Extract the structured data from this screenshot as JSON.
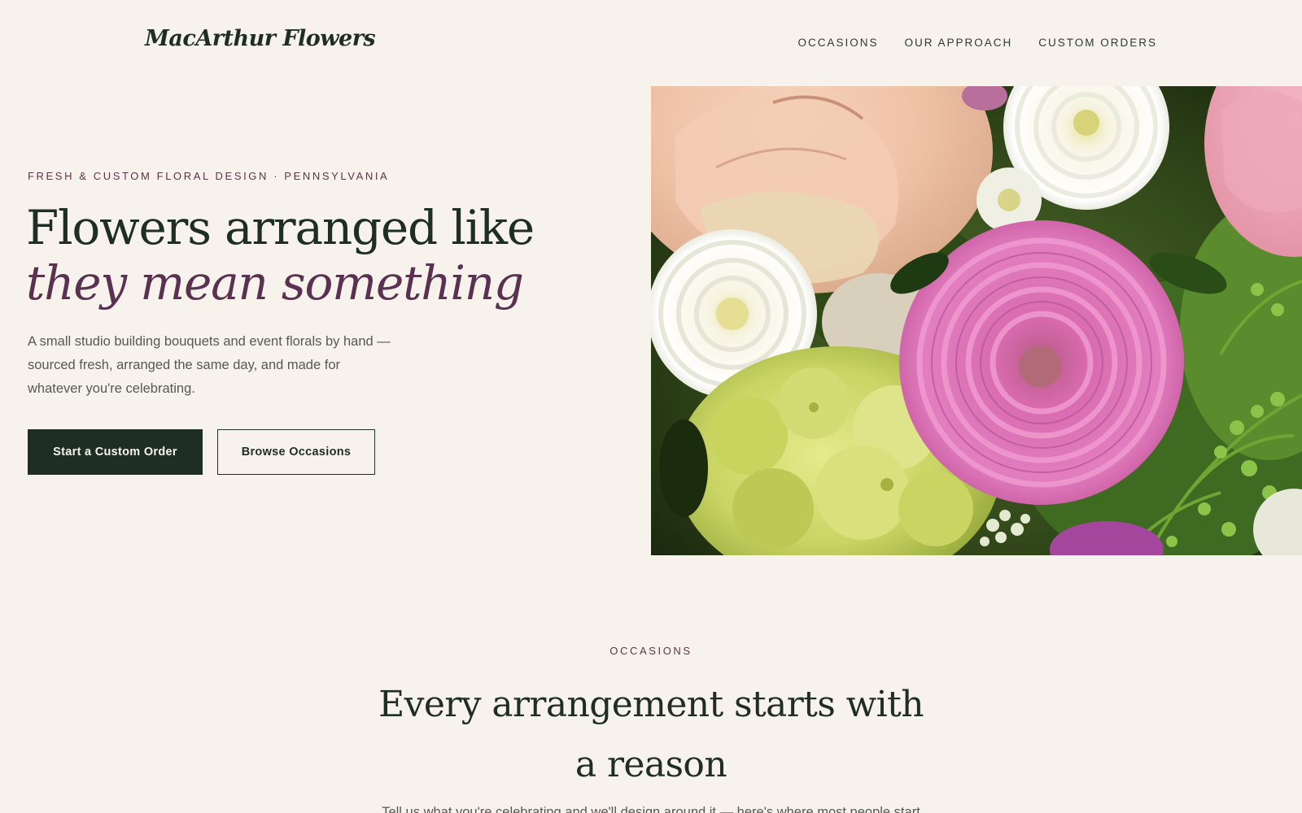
{
  "header": {
    "brand": "MacArthur Flowers",
    "nav": [
      {
        "label": "OCCASIONS"
      },
      {
        "label": "OUR APPROACH"
      },
      {
        "label": "CUSTOM ORDERS"
      }
    ]
  },
  "hero": {
    "eyebrow": "FRESH & CUSTOM FLORAL DESIGN · PENNSYLVANIA",
    "headline_line1": "Flowers arranged like",
    "headline_line2": "they mean something",
    "lede": "A small studio building bouquets and event florals by hand — sourced fresh, arranged the same day, and made for whatever you're celebrating.",
    "primary_cta": "Start a Custom Order",
    "secondary_cta": "Browse Occasions"
  },
  "occasions": {
    "eyebrow": "OCCASIONS",
    "title": "Every arrangement starts with a reason",
    "subtitle": "Tell us what you're celebrating and we'll design around it — here's where most people start"
  },
  "colors": {
    "background": "#f7f3ec",
    "ink": "#1f2e24",
    "accent_plum": "#5a3150",
    "muted_text": "#55594f"
  }
}
